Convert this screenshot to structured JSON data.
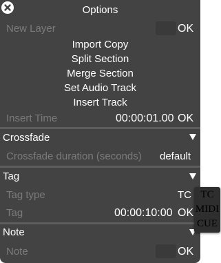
{
  "dialog": {
    "title": "Options"
  },
  "new_layer": {
    "label": "New Layer",
    "ok": "OK"
  },
  "menu": {
    "import_copy": "Import Copy",
    "split_section": "Split Section",
    "merge_section": "Merge Section",
    "set_audio_track": "Set Audio Track",
    "insert_track": "Insert Track"
  },
  "insert_time": {
    "label": "Insert Time",
    "value": "00:00:01.00",
    "ok": "OK"
  },
  "crossfade": {
    "header": "Crossfade",
    "duration_label": "Crossfade duration (seconds)",
    "duration_value": "default"
  },
  "tag": {
    "header": "Tag",
    "type_label": "Tag type",
    "type_value": "TC",
    "tag_label": "Tag",
    "tag_value": "00:00:10:00",
    "ok": "OK",
    "type_options": [
      "TC",
      "MIDI",
      "CUE"
    ]
  },
  "note": {
    "header": "Note",
    "label": "Note",
    "ok": "OK"
  },
  "colors": {
    "panel": "#434343",
    "dim_text": "#7b7b7b",
    "text": "#ffffff",
    "dropdown": "#2e2e2e"
  }
}
